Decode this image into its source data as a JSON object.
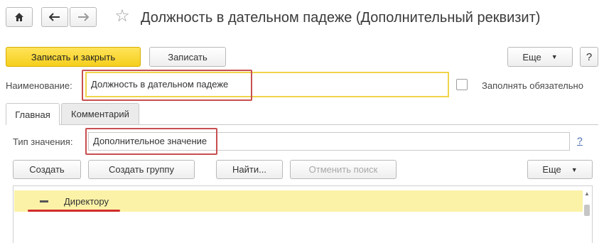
{
  "header": {
    "title": "Должность в дательном падеже (Дополнительный реквизит)",
    "home_icon": "home-icon",
    "back_icon": "arrow-left-icon",
    "forward_icon": "arrow-right-icon",
    "favorite_icon": "star-icon"
  },
  "toolbar": {
    "save_close_label": "Записать и закрыть",
    "save_label": "Записать",
    "more_label": "Еще",
    "help_label": "?"
  },
  "form": {
    "name_label": "Наименование:",
    "name_value": "Должность в дательном падеже",
    "required_label": "Заполнять обязательно"
  },
  "tabs": [
    {
      "label": "Главная"
    },
    {
      "label": "Комментарий"
    }
  ],
  "main": {
    "value_type_label": "Тип значения:",
    "value_type_value": "Дополнительное значение",
    "help_link": "?",
    "buttons": {
      "create": "Создать",
      "create_group": "Создать группу",
      "find": "Найти...",
      "cancel_search": "Отменить поиск",
      "more": "Еще"
    },
    "list_items": [
      {
        "label": "Директору"
      }
    ]
  },
  "colors": {
    "primary_button": "#f5cf1c",
    "selected_row": "#fbf2a7",
    "highlight_box": "#c84f4f",
    "focus_border": "#f0d44a"
  }
}
